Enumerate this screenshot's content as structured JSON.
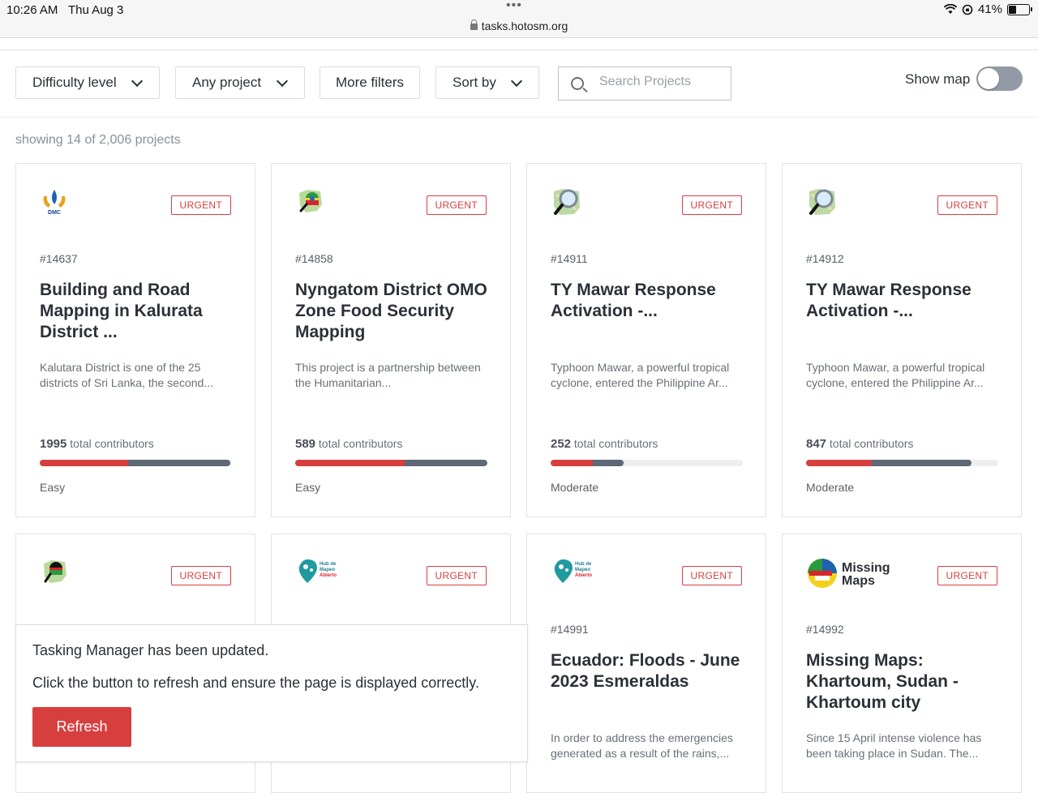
{
  "status_bar": {
    "time": "10:26 AM",
    "date": "Thu Aug 3",
    "url": "tasks.hotosm.org",
    "battery": "41%"
  },
  "filters": {
    "difficulty": "Difficulty level",
    "project": "Any project",
    "more": "More filters",
    "sort": "Sort by",
    "search_placeholder": "Search Projects",
    "show_map": "Show map"
  },
  "showing": "showing 14 of 2,006 projects",
  "colors": {
    "accent": "#d73f3f",
    "bar_validated": "#5d6776",
    "bar_empty": "#eeeeee"
  },
  "projects": [
    {
      "badge": "URGENT",
      "id": "#14637",
      "title": "Building and Road Mapping in Kalurata District ...",
      "desc": "Kalutara District is one of the 25 districts of Sri Lanka, the second...",
      "count": "1995",
      "contrib_label": "total contributors",
      "mapped": 0.46,
      "validated": 0.99,
      "difficulty": "Easy",
      "logo": "dmc-sri-lanka-logo",
      "logo_text": "DMC"
    },
    {
      "badge": "URGENT",
      "id": "#14858",
      "title": "Nyngatom District OMO Zone Food Security Mapping",
      "desc": "This project is a partnership between the Humanitarian...",
      "count": "589",
      "contrib_label": "total contributors",
      "mapped": 0.57,
      "validated": 1.0,
      "difficulty": "Easy",
      "logo": "ethiopia-map-logo"
    },
    {
      "badge": "URGENT",
      "id": "#14911",
      "title": "TY Mawar Response Activation -...",
      "desc": "Typhoon Mawar, a powerful tropical cyclone, entered the Philippine Ar...",
      "count": "252",
      "contrib_label": "total contributors",
      "mapped": 0.22,
      "validated": 0.38,
      "difficulty": "Moderate",
      "logo": "osm-magnifier-logo"
    },
    {
      "badge": "URGENT",
      "id": "#14912",
      "title": "TY Mawar Response Activation -...",
      "desc": "Typhoon Mawar, a powerful tropical cyclone, entered the Philippine Ar...",
      "count": "847",
      "contrib_label": "total contributors",
      "mapped": 0.34,
      "validated": 0.86,
      "difficulty": "Moderate",
      "logo": "osm-magnifier-logo"
    },
    {
      "badge": "URGENT",
      "id": "",
      "title": "",
      "desc": "",
      "logo": "malawi-map-logo"
    },
    {
      "badge": "URGENT",
      "id": "",
      "title": "",
      "desc": "",
      "logo": "hub-mapeo-abierto-logo",
      "logo_text": "Hub de Mapeo Abierto"
    },
    {
      "badge": "URGENT",
      "id": "#14991",
      "title": "Ecuador: Floods - June 2023 Esmeraldas",
      "desc": "In order to address the emergencies generated as a result of the rains,...",
      "logo": "hub-mapeo-abierto-logo",
      "logo_text": "Hub de Mapeo Abierto"
    },
    {
      "badge": "URGENT",
      "id": "#14992",
      "title": "Missing Maps: Khartoum, Sudan - Khartoum city",
      "desc": "Since 15 April intense violence has been taking place in Sudan. The...",
      "logo": "missing-maps-logo",
      "logo_text": "Missing Maps"
    }
  ],
  "toast": {
    "title": "Tasking Manager has been updated.",
    "message": "Click the button to refresh and ensure the page is displayed correctly.",
    "button": "Refresh"
  }
}
